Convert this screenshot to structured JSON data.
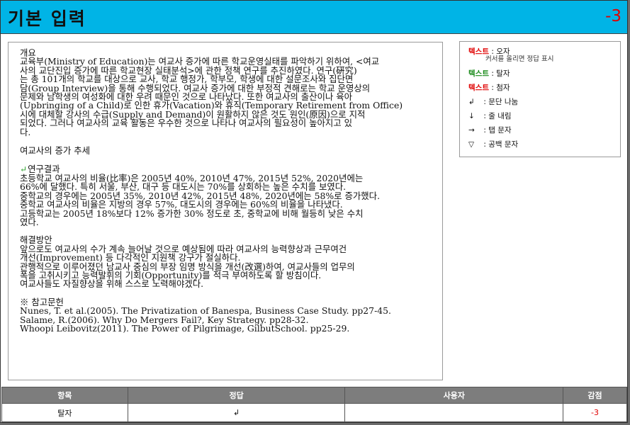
{
  "header": {
    "title": "기본 입력",
    "score": "-3"
  },
  "document": {
    "p1": [
      "개요",
      "교육부(Ministry of Education)는 여교사 증가에 따른 학교운영실태를 파악하기 위하여, <여교",
      "사의 교단진입 증가에 따른 학교현장 실태분석>에 관한 정책 연구를 추진하였다. 연구(硏究)",
      "는 총 101개의 학교를 대상으로 교사, 학교 행정가, 학부모, 학생에 대한 설문조사와 집단면",
      "담(Group Interview)을 통해 수행되었다. 여교사 증가에 대한 부정적 견해로는 학교 운영상의",
      "문제와 남학생의 여성화에 대한 우려 때문인 것으로 나타났다. 또한 여교사의 출산이나 육아",
      "(Upbringing of a Child)로 인한 휴가(Vacation)와 휴직(Temporary Retirement from Office)",
      "시에 대체할 강사의 수급(Supply and Demand)이 원활하지 않은 것도 원인(原因)으로 지적",
      "되었다. 그러나 여교사의 교육 활동은 우수한 것으로 나타나 여교사의 필요성이 높아지고 있",
      "다."
    ],
    "p2": "여교사의 증가 추세",
    "mark": "↵",
    "p3": [
      "연구결과",
      "초등학교 여교사의 비율(比率)은 2005년 40%, 2010년 47%, 2015년 52%, 2020년에는",
      "66%에 달했다. 특히 서울, 부산, 대구 등 대도시는 70%를 상회하는 높은 수치를 보였다.",
      "중학교의 경우에는 2005년 35%, 2010년 42%, 2015년 48%, 2020년에는 58%로 증가했다.",
      "중학교 여교사의 비율은 지방의 경우 57%, 대도시의 경우에는 60%의 비율을 나타냈다.",
      "고등학교는 2005년 18%보다 12% 증가한 30% 정도로 초, 중학교에 비해 월등히 낮은 수치",
      "였다."
    ],
    "p4": [
      "해결방안",
      "앞으로도 여교사의 수가 계속 늘어날 것으로 예상됨에 따라 여교사의 능력향상과 근무여건",
      "개선(Improvement) 등 다각적인 지원책 강구가 절실하다.",
      "관행적으로 이루어졌던 남교사 중심의 부장 임명 방식을 개선(改選)하여, 여교사들의 업무의",
      "폭을 고취시키고 능력발휘의 기회(Opportunity)를 적극 부여하도록 할 방침이다.",
      "여교사들도 자질향상을 위해 스스로 노력해야겠다."
    ],
    "p5": [
      "※ 참고문헌",
      "Nunes, T. et al.(2005). The Privatization of Banespa, Business Case Study. pp27-45.",
      "Salame, R.(2006). Why Do Mergers Fail?, Key Strategy. pp28-32.",
      "Whoopi Leibovitz(2011). The Power of Pilgrimage, GilbutSchool. pp25-29."
    ]
  },
  "legend": {
    "typo_word": "텍스트",
    "typo_desc": ": 오자",
    "typo_hint": "커서를 올리면 정답 표시",
    "omit_word": "텍스트",
    "omit_desc": ": 탈자",
    "add_word": "텍스트",
    "add_desc": ": 첨자",
    "para_sym": "↲",
    "para_desc": ": 문단 나눔",
    "line_sym": "↓",
    "line_desc": ": 줄 내림",
    "tab_sym": "→",
    "tab_desc": ": 탭 문자",
    "space_sym": "▽",
    "space_desc": ": 공백 문자"
  },
  "table": {
    "headers": [
      "항목",
      "정답",
      "사용자",
      "감점"
    ],
    "row": [
      "탈자",
      "↲",
      "",
      "-3"
    ]
  }
}
